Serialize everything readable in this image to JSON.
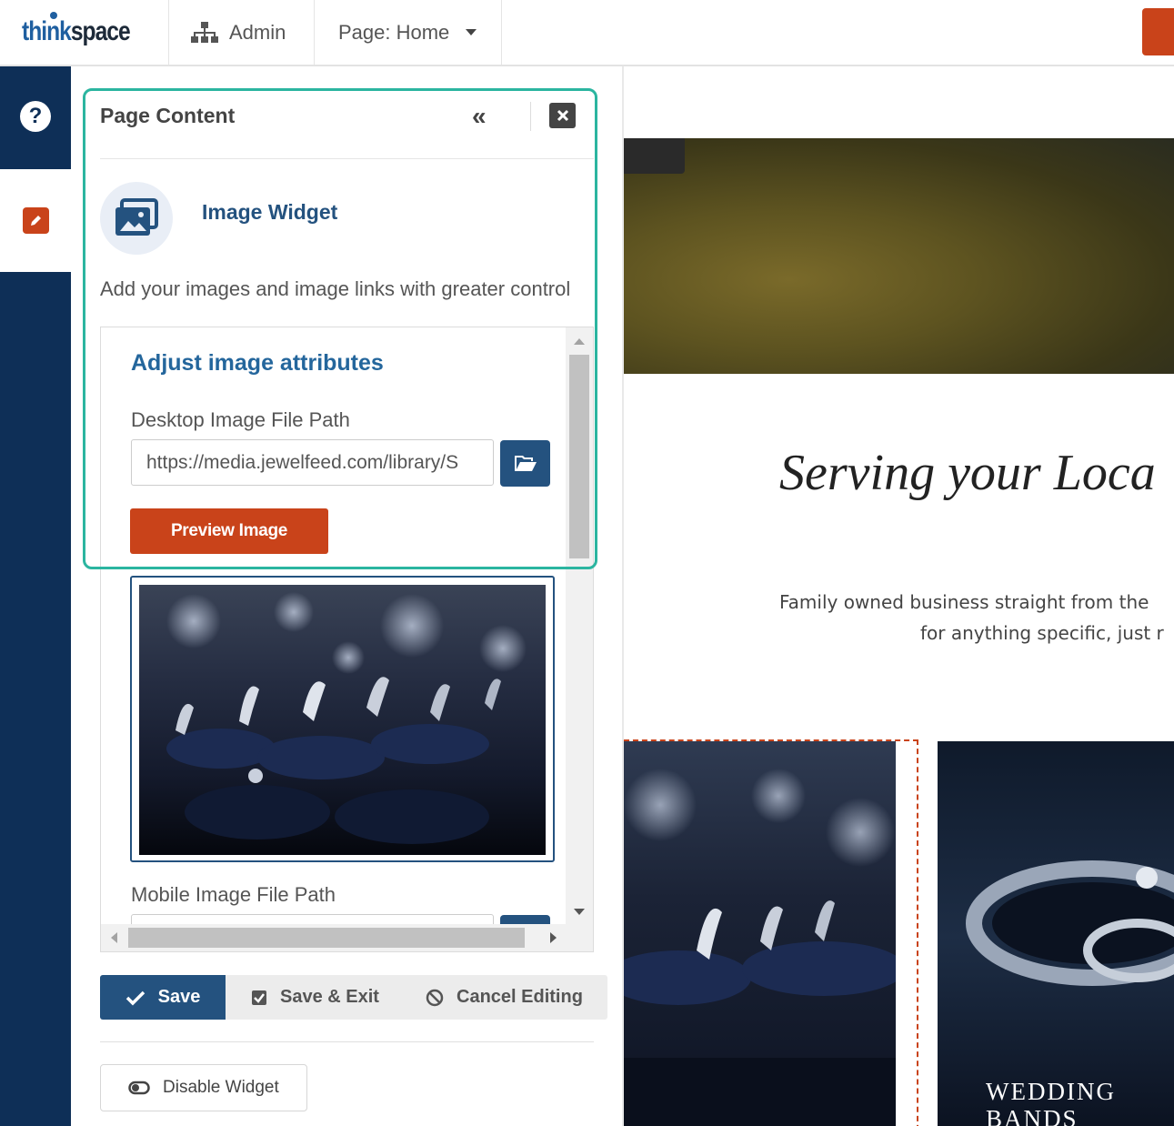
{
  "topbar": {
    "logo_think": "think",
    "logo_space": "space",
    "admin_label": "Admin",
    "page_label": "Page: Home"
  },
  "panel": {
    "title": "Page Content",
    "widget_name": "Image Widget",
    "widget_description": "Add your images and image links with greater control",
    "section_title": "Adjust image attributes",
    "desktop_label": "Desktop Image File Path",
    "desktop_path": "https://media.jewelfeed.com/library/S",
    "preview_label": "Preview Image",
    "mobile_label": "Mobile Image File Path",
    "save_label": "Save",
    "save_exit_label": "Save & Exit",
    "cancel_label": "Cancel Editing",
    "disable_label": "Disable Widget"
  },
  "site": {
    "headline": "Serving your Loca",
    "body_line1": "Family owned business straight from the",
    "body_line2": "for anything specific, just r",
    "tile_caption_line1": "WEDDING",
    "tile_caption_line2": "BANDS"
  },
  "colors": {
    "navy": "#0e2f57",
    "brand_blue": "#24527f",
    "accent_orange": "#c9431a",
    "highlight_teal": "#2bb5a0"
  }
}
